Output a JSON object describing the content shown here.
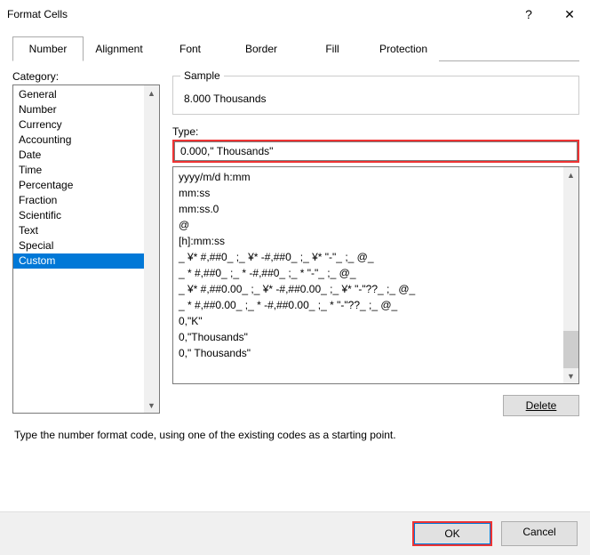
{
  "title": "Format Cells",
  "help_glyph": "?",
  "close_glyph": "✕",
  "tabs": [
    "Number",
    "Alignment",
    "Font",
    "Border",
    "Fill",
    "Protection"
  ],
  "active_tab": 0,
  "category_label": "Category:",
  "categories": [
    "General",
    "Number",
    "Currency",
    "Accounting",
    "Date",
    "Time",
    "Percentage",
    "Fraction",
    "Scientific",
    "Text",
    "Special",
    "Custom"
  ],
  "selected_category": 11,
  "sample_label": "Sample",
  "sample_value": "8.000 Thousands",
  "type_label": "Type:",
  "type_value": "0.000,\" Thousands\"",
  "formats": [
    "yyyy/m/d h:mm",
    "mm:ss",
    "mm:ss.0",
    "@",
    "[h]:mm:ss",
    "_ ¥* #,##0_ ;_ ¥* -#,##0_ ;_ ¥* \"-\"_ ;_ @_ ",
    "_ * #,##0_ ;_ * -#,##0_ ;_ * \"-\"_ ;_ @_ ",
    "_ ¥* #,##0.00_ ;_ ¥* -#,##0.00_ ;_ ¥* \"-\"??_ ;_ @_ ",
    "_ * #,##0.00_ ;_ * -#,##0.00_ ;_ * \"-\"??_ ;_ @_ ",
    "0,\"K\"",
    "0,\"Thousands\"",
    "0,\" Thousands\""
  ],
  "delete_label": "Delete",
  "hint": "Type the number format code, using one of the existing codes as a starting point.",
  "ok_label": "OK",
  "cancel_label": "Cancel"
}
